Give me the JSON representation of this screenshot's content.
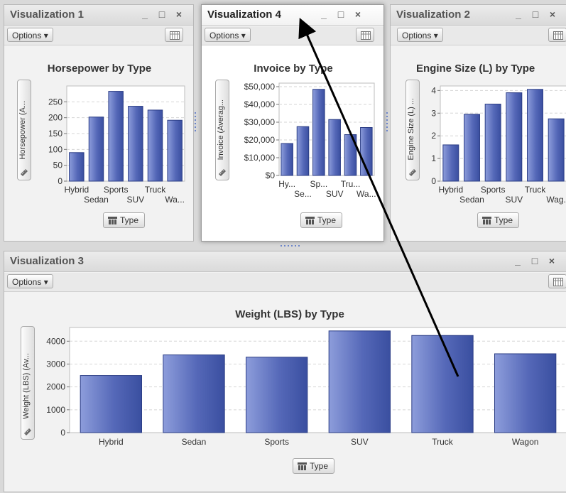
{
  "panels": {
    "viz1": {
      "title": "Visualization 1",
      "options_label": "Options",
      "chart_title": "Horsepower by Type",
      "y_label": "Horsepower (A...",
      "type_button": "Type"
    },
    "viz4": {
      "title": "Visualization 4",
      "options_label": "Options",
      "chart_title": "Invoice by Type",
      "y_label": "Invoice (Averag...",
      "type_button": "Type"
    },
    "viz2": {
      "title": "Visualization 2",
      "options_label": "Options",
      "chart_title": "Engine Size (L) by Type",
      "y_label": "Engine Size (L) ...",
      "type_button": "Type"
    },
    "viz3": {
      "title": "Visualization 3",
      "options_label": "Options",
      "chart_title": "Weight (LBS) by Type",
      "y_label": "Weight (LBS) (Av...",
      "type_button": "Type"
    }
  },
  "window_controls": {
    "minimize": "_",
    "maximize": "□",
    "close": "×"
  },
  "colors": {
    "bar_dark": "#3a4fa0",
    "bar_light": "#8d9ddb",
    "arrow": "#000000"
  },
  "chart_data": [
    {
      "type": "bar",
      "title": "Horsepower by Type",
      "ylabel": "Horsepower (A...",
      "categories": [
        "Hybrid",
        "Sedan",
        "Sports",
        "SUV",
        "Truck",
        "Wagon"
      ],
      "tick_labels_upper": [
        "Hybrid",
        "Sports",
        "Truck"
      ],
      "tick_labels_lower": [
        "Sedan",
        "SUV",
        "Wa..."
      ],
      "values": [
        90,
        202,
        283,
        236,
        224,
        192
      ],
      "yticks": [
        0,
        50,
        100,
        150,
        200,
        250
      ],
      "ytick_labels": [
        "0",
        "50",
        "100",
        "150",
        "200",
        "250"
      ],
      "ylim": [
        0,
        300
      ]
    },
    {
      "type": "bar",
      "title": "Invoice by Type",
      "ylabel": "Invoice (Averag...",
      "categories": [
        "Hybrid",
        "Sedan",
        "Sports",
        "SUV",
        "Truck",
        "Wagon"
      ],
      "tick_labels_upper": [
        "Hy...",
        "Sp...",
        "Tru..."
      ],
      "tick_labels_lower": [
        "Se...",
        "SUV",
        "Wa..."
      ],
      "values": [
        18000,
        27500,
        48500,
        31500,
        23000,
        27000
      ],
      "yticks": [
        0,
        10000,
        20000,
        30000,
        40000,
        50000
      ],
      "ytick_labels": [
        "$0",
        "$10,000",
        "$20,000",
        "$30,000",
        "$40,000",
        "$50,000"
      ],
      "ylim": [
        0,
        52000
      ]
    },
    {
      "type": "bar",
      "title": "Engine Size (L) by Type",
      "ylabel": "Engine Size (L) ...",
      "categories": [
        "Hybrid",
        "Sedan",
        "Sports",
        "SUV",
        "Truck",
        "Wagon"
      ],
      "tick_labels_upper": [
        "Hybrid",
        "Sports",
        "Truck"
      ],
      "tick_labels_lower": [
        "Sedan",
        "SUV",
        "Wag."
      ],
      "values": [
        1.6,
        2.95,
        3.4,
        3.9,
        4.05,
        2.75
      ],
      "yticks": [
        0,
        1,
        2,
        3,
        4
      ],
      "ytick_labels": [
        "0",
        "1",
        "2",
        "3",
        "4"
      ],
      "ylim": [
        0,
        4.2
      ]
    },
    {
      "type": "bar",
      "title": "Weight (LBS) by Type",
      "ylabel": "Weight (LBS) (Av...",
      "categories": [
        "Hybrid",
        "Sedan",
        "Sports",
        "SUV",
        "Truck",
        "Wagon"
      ],
      "tick_labels_upper": [
        "Hybrid",
        "Sedan",
        "Sports",
        "SUV",
        "Truck",
        "Wagon"
      ],
      "tick_labels_lower": [],
      "values": [
        2500,
        3400,
        3300,
        4450,
        4250,
        3450
      ],
      "yticks": [
        0,
        1000,
        2000,
        3000,
        4000
      ],
      "ytick_labels": [
        "0",
        "1000",
        "2000",
        "3000",
        "4000"
      ],
      "ylim": [
        0,
        4600
      ]
    }
  ]
}
